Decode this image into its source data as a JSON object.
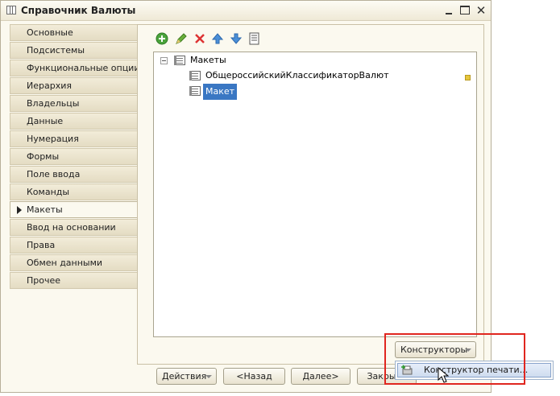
{
  "window": {
    "title": "Справочник Валюты",
    "controls": [
      "minimize-icon",
      "maximize-icon",
      "close-icon"
    ]
  },
  "tabs": [
    {
      "label": "Основные",
      "active": false
    },
    {
      "label": "Подсистемы",
      "active": false
    },
    {
      "label": "Функциональные опции",
      "active": false
    },
    {
      "label": "Иерархия",
      "active": false
    },
    {
      "label": "Владельцы",
      "active": false
    },
    {
      "label": "Данные",
      "active": false
    },
    {
      "label": "Нумерация",
      "active": false
    },
    {
      "label": "Формы",
      "active": false
    },
    {
      "label": "Поле ввода",
      "active": false
    },
    {
      "label": "Команды",
      "active": false
    },
    {
      "label": "Макеты",
      "active": true
    },
    {
      "label": "Ввод на основании",
      "active": false
    },
    {
      "label": "Права",
      "active": false
    },
    {
      "label": "Обмен данными",
      "active": false
    },
    {
      "label": "Прочее",
      "active": false
    }
  ],
  "toolbar": {
    "icons": [
      "add-icon",
      "edit-icon",
      "delete-icon",
      "move-up-icon",
      "move-down-icon",
      "list-icon"
    ]
  },
  "tree": {
    "root": {
      "label": "Макеты",
      "expanded": true
    },
    "children": [
      {
        "label": "ОбщероссийскийКлассификаторВалют",
        "selected": false,
        "flag": true
      },
      {
        "label": "Макет",
        "selected": true,
        "flag": false
      }
    ]
  },
  "buttons": {
    "constructors_label": "Конструкторы",
    "actions_label": "Действия",
    "back_label": "<Назад",
    "next_label": "Далее>",
    "close_label": "Закрыть"
  },
  "popup": {
    "item_label": "Конструктор печати..."
  },
  "colors": {
    "selection": "#3a77c3",
    "highlight_border": "#e0261f",
    "window_bg": "#fbf9ef"
  }
}
